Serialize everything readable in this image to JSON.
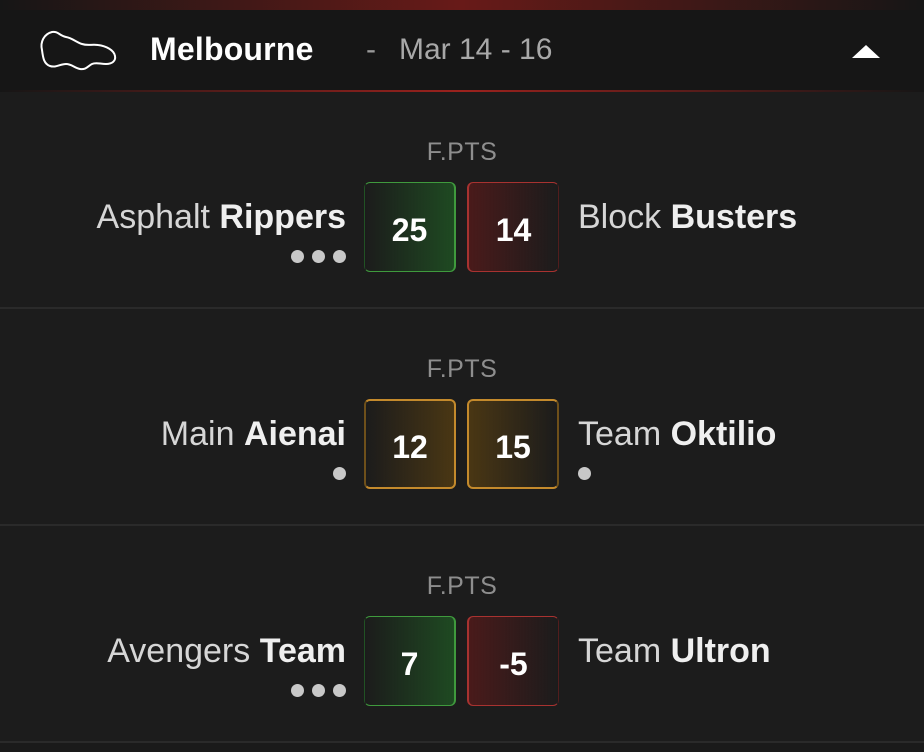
{
  "header": {
    "circuit_icon": "track-outline-icon",
    "circuit_name": "Melbourne",
    "separator": "-",
    "dates": "Mar 14 - 16",
    "collapse_icon": "chevron-up-icon"
  },
  "matches": [
    {
      "score_label": "F.PTS",
      "left_team": {
        "first": "Asphalt",
        "last": "Rippers",
        "score": "25",
        "result": "win",
        "dots": 3
      },
      "right_team": {
        "first": "Block",
        "last": "Busters",
        "score": "14",
        "result": "lose",
        "dots": 0
      }
    },
    {
      "score_label": "F.PTS",
      "left_team": {
        "first": "Main",
        "last": "Aienai",
        "score": "12",
        "result": "draw",
        "dots": 1
      },
      "right_team": {
        "first": "Team",
        "last": "Oktilio",
        "score": "15",
        "result": "draw",
        "dots": 1
      }
    },
    {
      "score_label": "F.PTS",
      "left_team": {
        "first": "Avengers",
        "last": "Team",
        "score": "7",
        "result": "win",
        "dots": 3
      },
      "right_team": {
        "first": "Team",
        "last": "Ultron",
        "score": "-5",
        "result": "lose",
        "dots": 0
      }
    }
  ],
  "colors": {
    "win": "#3f9a3d",
    "lose": "#a83230",
    "draw": "#c48a2c",
    "accent": "#aa231e"
  }
}
